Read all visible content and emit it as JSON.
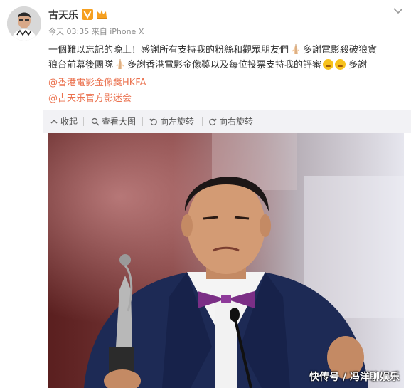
{
  "post": {
    "username": "古天乐",
    "timestamp": "今天 03:35",
    "source": "来自 iPhone X",
    "text_line1": "一個難以忘記的晚上！感謝所有支持我的粉絲和觀眾朋友們",
    "text_line1b": "多謝電影殺破狼貪",
    "text_line2": "狼台前幕後團隊",
    "text_line2b": "多謝香港電影金像獎以及每位投票支持我的評審",
    "text_line2c": "多謝",
    "mention1": "@香港電影金像獎HKFA",
    "mention2": "@古天乐官方影迷会"
  },
  "toolbar": {
    "collect": "收起",
    "view_large": "查看大图",
    "rotate_left": "向左旋转",
    "rotate_right": "向右旋转"
  },
  "photo": {
    "watermark": "快传号 / 冯洋聊娱乐"
  },
  "colors": {
    "mention": "#eb7350",
    "badge": "#f6a020",
    "toolbar_bg": "#f2f2f5",
    "suit": "#1d2a55",
    "bowtie": "#7b2f86"
  }
}
